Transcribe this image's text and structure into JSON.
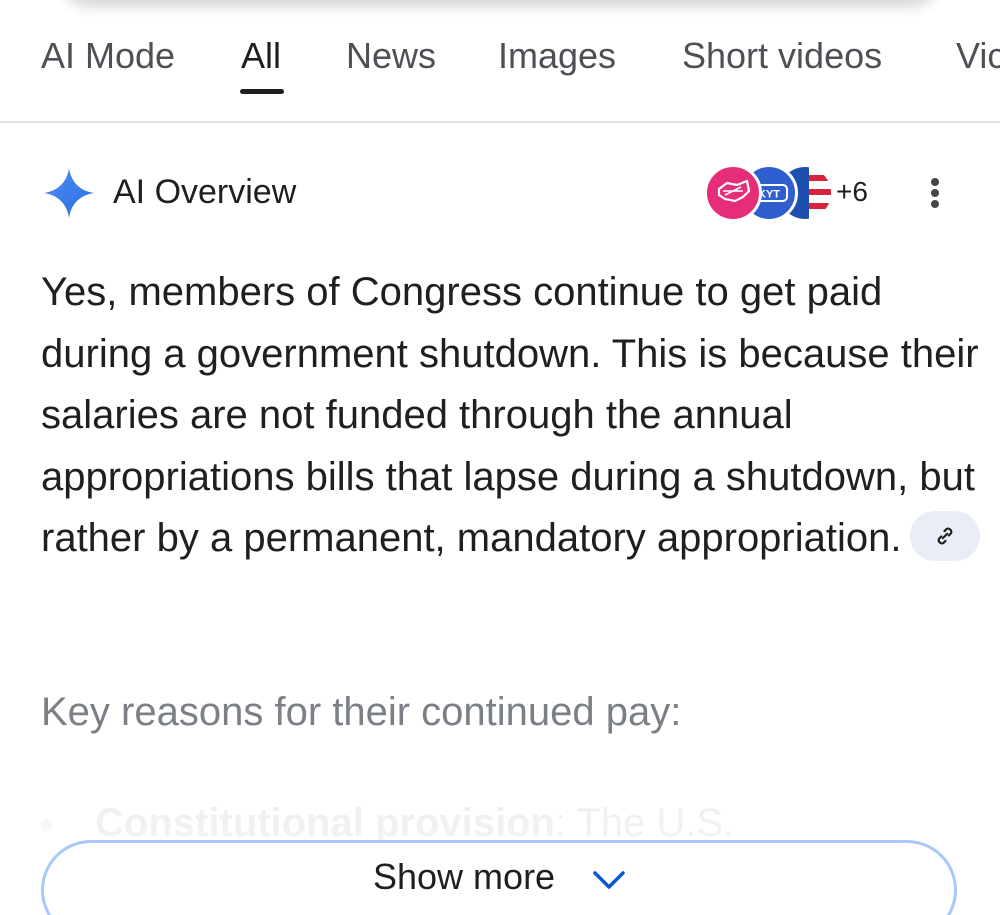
{
  "tabs": [
    {
      "label": "AI Mode",
      "active": false
    },
    {
      "label": "All",
      "active": true
    },
    {
      "label": "News",
      "active": false
    },
    {
      "label": "Images",
      "active": false
    },
    {
      "label": "Short videos",
      "active": false
    },
    {
      "label": "Vic",
      "active": false
    }
  ],
  "ai_overview": {
    "title": "AI Overview",
    "sources_more": "+6",
    "sources": [
      {
        "name": "source-1",
        "color": "#e52d7a"
      },
      {
        "name": "source-2",
        "label": "KYT",
        "color": "#2f5fcf"
      },
      {
        "name": "source-3",
        "color": "#1f4fae"
      }
    ],
    "answer": "Yes, members of Congress continue to get paid during a government shutdown. This is because their salaries are not funded through the annual appropriations bills that lapse during a shutdown, but rather by a permanent, mandatory appropriation.",
    "key_reasons_heading": "Key reasons for their continued pay:",
    "list_first_bold": "Constitutional provision",
    "list_first_text": ": The U.S.",
    "show_more_label": "Show more"
  },
  "colors": {
    "accent": "#4285f4",
    "chip_bg": "#e9eef6",
    "show_more_border": "#a8c7fa",
    "text": "#1f1f1f"
  }
}
